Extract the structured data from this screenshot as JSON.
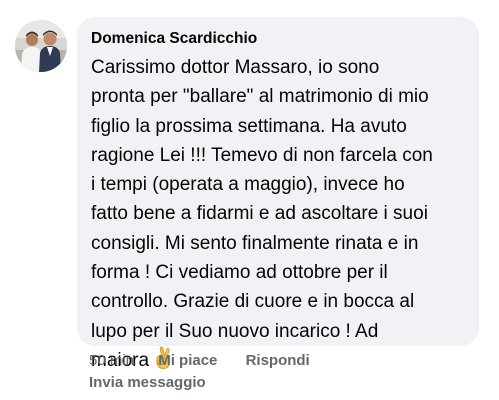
{
  "comment": {
    "author": "Domenica Scardicchio",
    "text_lines": [
      "Carissimo dottor Massaro, io sono",
      "pronta per \"ballare\" al matrimonio di mio",
      "figlio la prossima settimana. Ha avuto",
      "ragione Lei !!! Temevo di non farcela con",
      "i tempi (operata a maggio), invece ho",
      "fatto bene a fidarmi e ad ascoltare i suoi",
      "consigli. Mi sento finalmente rinata e in",
      "forma ! Ci vediamo ad ottobre per il",
      "controllo. Grazie di cuore e in bocca al",
      "lupo per il Suo nuovo incarico ! Ad",
      "maiora"
    ],
    "trailing_emoji": "crossed-fingers-emoji"
  },
  "actions": {
    "timestamp": "50 min",
    "like_label": "Mi piace",
    "reply_label": "Rispondi",
    "send_message_label": "Invia messaggio"
  },
  "colors": {
    "bubble_bg": "#f0f2f5",
    "text": "#050505",
    "meta_text": "#65676b",
    "emoji_skin": "#f6c445"
  }
}
